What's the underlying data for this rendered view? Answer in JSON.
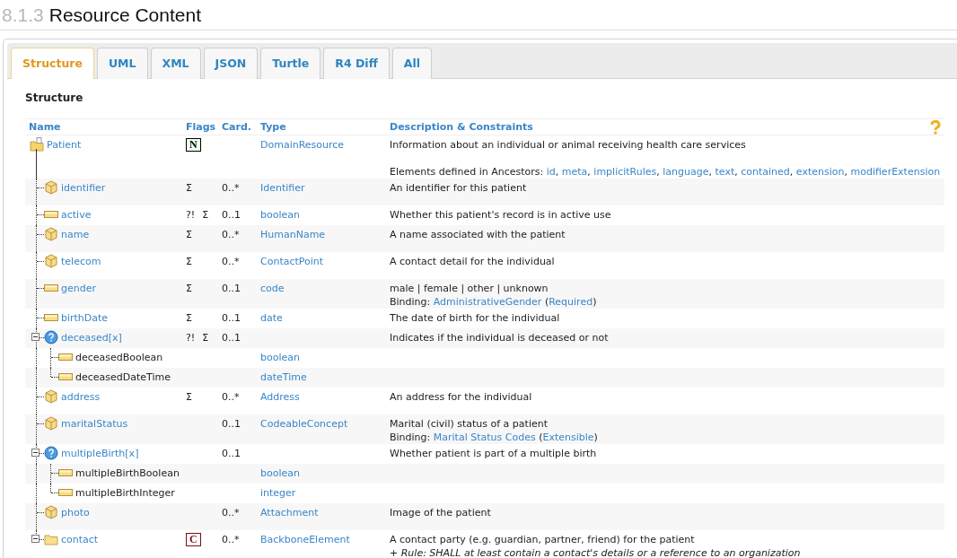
{
  "heading": {
    "number": "8.1.3",
    "title": "Resource Content"
  },
  "tabs": [
    {
      "label": "Structure",
      "selected": true
    },
    {
      "label": "UML",
      "selected": false
    },
    {
      "label": "XML",
      "selected": false
    },
    {
      "label": "JSON",
      "selected": false
    },
    {
      "label": "Turtle",
      "selected": false
    },
    {
      "label": "R4 Diff",
      "selected": false
    },
    {
      "label": "All",
      "selected": false
    }
  ],
  "section_title": "Structure",
  "table": {
    "columns": [
      "Name",
      "Flags",
      "Card.",
      "Type",
      "Description & Constraints"
    ],
    "rows": [
      {
        "name": "Patient",
        "kind": "resource",
        "link": true,
        "flags": [
          {
            "text": "N",
            "kind": "normative"
          }
        ],
        "type": "DomainResource",
        "description": [
          {
            "kind": "plain",
            "segments": [
              {
                "text": "Information about an individual or animal receiving health care services",
                "kind": "text"
              }
            ]
          },
          {
            "kind": "note",
            "segments": [
              {
                "text": "Elements defined in Ancestors: ",
                "kind": "text"
              },
              {
                "text": "id",
                "kind": "link"
              },
              {
                "text": ", ",
                "kind": "text"
              },
              {
                "text": "meta",
                "kind": "link"
              },
              {
                "text": ", ",
                "kind": "text"
              },
              {
                "text": "implicitRules",
                "kind": "link"
              },
              {
                "text": ", ",
                "kind": "text"
              },
              {
                "text": "language",
                "kind": "link"
              },
              {
                "text": ", ",
                "kind": "text"
              },
              {
                "text": "text",
                "kind": "link"
              },
              {
                "text": ", ",
                "kind": "text"
              },
              {
                "text": "contained",
                "kind": "link"
              },
              {
                "text": ", ",
                "kind": "text"
              },
              {
                "text": "extension",
                "kind": "link"
              },
              {
                "text": ", ",
                "kind": "text"
              },
              {
                "text": "modifierExtension",
                "kind": "link"
              }
            ]
          }
        ],
        "children": [
          {
            "name": "identifier",
            "kind": "complex",
            "link": true,
            "flags": [
              {
                "text": "Σ",
                "kind": "plain"
              }
            ],
            "card": "0..*",
            "type": "Identifier",
            "description": [
              {
                "kind": "plain",
                "segments": [
                  {
                    "text": "An identifier for this patient",
                    "kind": "text"
                  }
                ]
              }
            ]
          },
          {
            "name": "active",
            "kind": "primitive",
            "link": true,
            "flags": [
              {
                "text": "?!",
                "kind": "plain"
              },
              {
                "text": "Σ",
                "kind": "plain"
              }
            ],
            "card": "0..1",
            "type": "boolean",
            "description": [
              {
                "kind": "plain",
                "segments": [
                  {
                    "text": "Whether this patient's record is in active use",
                    "kind": "text"
                  }
                ]
              }
            ]
          },
          {
            "name": "name",
            "kind": "complex",
            "link": true,
            "flags": [
              {
                "text": "Σ",
                "kind": "plain"
              }
            ],
            "card": "0..*",
            "type": "HumanName",
            "description": [
              {
                "kind": "plain",
                "segments": [
                  {
                    "text": "A name associated with the patient",
                    "kind": "text"
                  }
                ]
              }
            ]
          },
          {
            "name": "telecom",
            "kind": "complex",
            "link": true,
            "flags": [
              {
                "text": "Σ",
                "kind": "plain"
              }
            ],
            "card": "0..*",
            "type": "ContactPoint",
            "description": [
              {
                "kind": "plain",
                "segments": [
                  {
                    "text": "A contact detail for the individual",
                    "kind": "text"
                  }
                ]
              }
            ]
          },
          {
            "name": "gender",
            "kind": "primitive",
            "link": true,
            "flags": [
              {
                "text": "Σ",
                "kind": "plain"
              }
            ],
            "card": "0..1",
            "type": "code",
            "description": [
              {
                "kind": "plain",
                "segments": [
                  {
                    "text": "male | female | other | unknown",
                    "kind": "text"
                  }
                ]
              },
              {
                "kind": "plain",
                "segments": [
                  {
                    "text": "Binding: ",
                    "kind": "text"
                  },
                  {
                    "text": "AdministrativeGender",
                    "kind": "link"
                  },
                  {
                    "text": " (",
                    "kind": "text"
                  },
                  {
                    "text": "Required",
                    "kind": "link"
                  },
                  {
                    "text": ")",
                    "kind": "text"
                  }
                ]
              }
            ]
          },
          {
            "name": "birthDate",
            "kind": "primitive",
            "link": true,
            "flags": [
              {
                "text": "Σ",
                "kind": "plain"
              }
            ],
            "card": "0..1",
            "type": "date",
            "description": [
              {
                "kind": "plain",
                "segments": [
                  {
                    "text": "The date of birth for the individual",
                    "kind": "text"
                  }
                ]
              }
            ]
          },
          {
            "name": "deceased[x]",
            "kind": "choice",
            "link": true,
            "expanded": true,
            "flags": [
              {
                "text": "?!",
                "kind": "plain"
              },
              {
                "text": "Σ",
                "kind": "plain"
              }
            ],
            "card": "0..1",
            "description": [
              {
                "kind": "plain",
                "segments": [
                  {
                    "text": "Indicates if the individual is deceased or not",
                    "kind": "text"
                  }
                ]
              }
            ],
            "children": [
              {
                "name": "deceasedBoolean",
                "kind": "primitive",
                "link": false,
                "type": "boolean"
              },
              {
                "name": "deceasedDateTime",
                "kind": "primitive",
                "link": false,
                "type": "dateTime"
              }
            ]
          },
          {
            "name": "address",
            "kind": "complex",
            "link": true,
            "flags": [
              {
                "text": "Σ",
                "kind": "plain"
              }
            ],
            "card": "0..*",
            "type": "Address",
            "description": [
              {
                "kind": "plain",
                "segments": [
                  {
                    "text": "An address for the individual",
                    "kind": "text"
                  }
                ]
              }
            ]
          },
          {
            "name": "maritalStatus",
            "kind": "complex",
            "link": true,
            "card": "0..1",
            "type": "CodeableConcept",
            "description": [
              {
                "kind": "plain",
                "segments": [
                  {
                    "text": "Marital (civil) status of a patient",
                    "kind": "text"
                  }
                ]
              },
              {
                "kind": "plain",
                "segments": [
                  {
                    "text": "Binding: ",
                    "kind": "text"
                  },
                  {
                    "text": "Marital Status Codes",
                    "kind": "link"
                  },
                  {
                    "text": " (",
                    "kind": "text"
                  },
                  {
                    "text": "Extensible",
                    "kind": "link"
                  },
                  {
                    "text": ")",
                    "kind": "text"
                  }
                ]
              }
            ]
          },
          {
            "name": "multipleBirth[x]",
            "kind": "choice",
            "link": true,
            "expanded": true,
            "card": "0..1",
            "description": [
              {
                "kind": "plain",
                "segments": [
                  {
                    "text": "Whether patient is part of a multiple birth",
                    "kind": "text"
                  }
                ]
              }
            ],
            "children": [
              {
                "name": "multipleBirthBoolean",
                "kind": "primitive",
                "link": false,
                "type": "boolean"
              },
              {
                "name": "multipleBirthInteger",
                "kind": "primitive",
                "link": false,
                "type": "integer"
              }
            ]
          },
          {
            "name": "photo",
            "kind": "complex",
            "link": true,
            "card": "0..*",
            "type": "Attachment",
            "description": [
              {
                "kind": "plain",
                "segments": [
                  {
                    "text": "Image of the patient",
                    "kind": "text"
                  }
                ]
              }
            ]
          },
          {
            "name": "contact",
            "kind": "backbone",
            "link": true,
            "expanded": true,
            "flags": [
              {
                "text": "C",
                "kind": "constraint"
              }
            ],
            "card": "0..*",
            "type": "BackboneElement",
            "description": [
              {
                "kind": "plain",
                "segments": [
                  {
                    "text": "A contact party (e.g. guardian, partner, friend) for the patient",
                    "kind": "text"
                  }
                ]
              },
              {
                "kind": "rule",
                "segments": [
                  {
                    "text": "+ Rule: SHALL at least contain a contact's details or a reference to an organization",
                    "kind": "text"
                  }
                ]
              }
            ]
          }
        ]
      }
    ]
  }
}
